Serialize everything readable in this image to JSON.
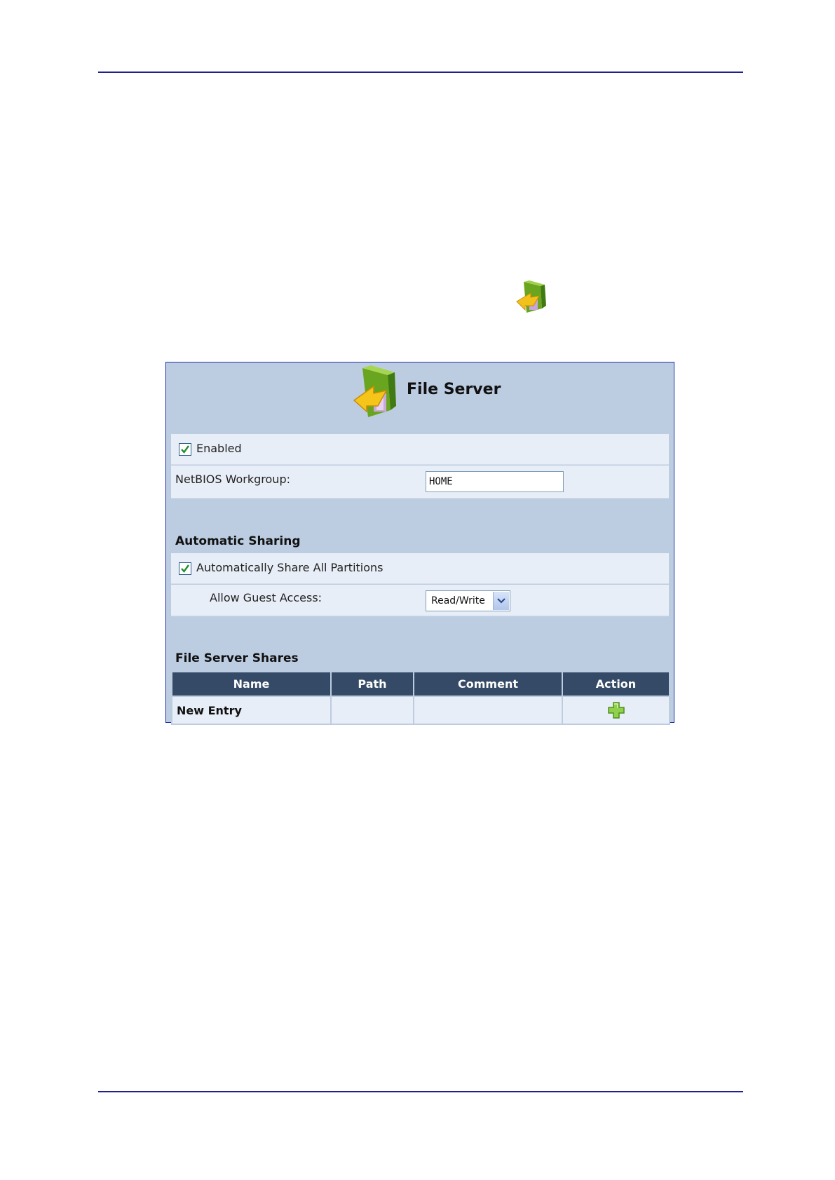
{
  "panel": {
    "title": "File Server",
    "icon": "file-server-icon"
  },
  "enabled": {
    "label": "Enabled",
    "checked": true
  },
  "netbios": {
    "label": "NetBIOS Workgroup:",
    "value": "HOME"
  },
  "automatic_sharing": {
    "heading": "Automatic Sharing",
    "share_all_label": "Automatically Share All Partitions",
    "share_all_checked": true,
    "guest_label": "Allow Guest Access:",
    "guest_value": "Read/Write"
  },
  "shares": {
    "heading": "File Server Shares",
    "columns": [
      "Name",
      "Path",
      "Comment",
      "Action"
    ],
    "new_entry_label": "New Entry",
    "action_icon": "add-icon"
  },
  "colors": {
    "panel_bg": "#bccde2",
    "row_bg": "#e8eef7",
    "table_header_bg": "#344a66",
    "rule": "#1f1f8f"
  }
}
